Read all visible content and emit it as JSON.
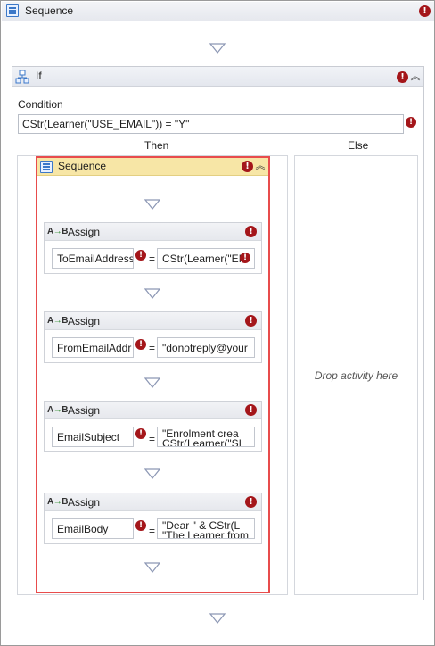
{
  "outer_sequence": {
    "title": "Sequence",
    "error_icon": "error-icon"
  },
  "if_activity": {
    "title": "If",
    "condition_label": "Condition",
    "condition_value": "CStr(Learner(\"USE_EMAIL\")) = \"Y\"",
    "then_label": "Then",
    "else_label": "Else",
    "else_placeholder": "Drop activity here"
  },
  "inner_sequence": {
    "title": "Sequence",
    "selected": true,
    "selection_color": "#e84c4c"
  },
  "assigns": [
    {
      "title": "Assign",
      "to": "ToEmailAddress",
      "value_line1": "CStr(Learner(\"EI",
      "value_line2": ""
    },
    {
      "title": "Assign",
      "to": "FromEmailAddr",
      "value_line1": "\"donotreply@your",
      "value_line2": ""
    },
    {
      "title": "Assign",
      "to": "EmailSubject",
      "value_line1": "\"Enrolment crea",
      "value_line2": "CStr(Learner(\"SI"
    },
    {
      "title": "Assign",
      "to": "EmailBody",
      "value_line1": "\"Dear \" & CStr(L",
      "value_line2": "\"The Learner from"
    }
  ],
  "assign_operator": "=",
  "colors": {
    "header_bg": "#e6e8ee",
    "selected_header_bg": "#f7e6a6",
    "error_red": "#a4161a",
    "border": "#c9ccd3"
  },
  "icons": {
    "sequence": "sequence-icon",
    "if": "if-icon",
    "assign": "assign-icon",
    "error": "error-icon",
    "collapse": "collapse-icon",
    "drop_target": "drop-arrow-icon"
  }
}
